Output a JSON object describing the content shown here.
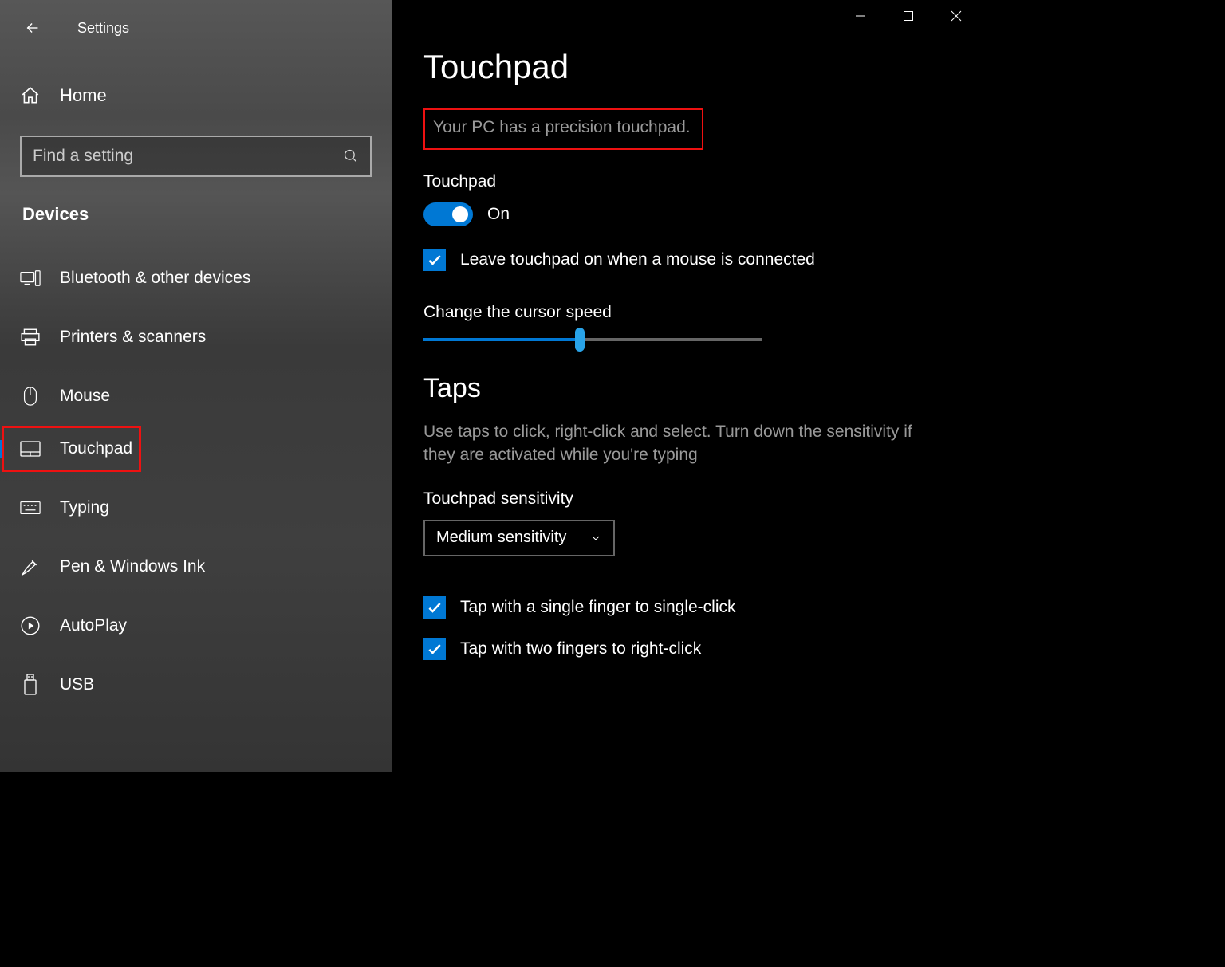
{
  "appTitle": "Settings",
  "home": "Home",
  "searchPlaceholder": "Find a setting",
  "category": "Devices",
  "nav": [
    {
      "label": "Bluetooth & other devices"
    },
    {
      "label": "Printers & scanners"
    },
    {
      "label": "Mouse"
    },
    {
      "label": "Touchpad"
    },
    {
      "label": "Typing"
    },
    {
      "label": "Pen & Windows Ink"
    },
    {
      "label": "AutoPlay"
    },
    {
      "label": "USB"
    }
  ],
  "page": {
    "title": "Touchpad",
    "precisionMsg": "Your PC has a precision touchpad.",
    "touchpadLabel": "Touchpad",
    "toggleState": "On",
    "leaveOn": "Leave touchpad on when a mouse is connected",
    "cursorSpeed": "Change the cursor speed",
    "tapsTitle": "Taps",
    "tapsDesc": "Use taps to click, right-click and select. Turn down the sensitivity if they are activated while you're typing",
    "sensitivityLabel": "Touchpad sensitivity",
    "sensitivityValue": "Medium sensitivity",
    "tapSingle": "Tap with a single finger to single-click",
    "tapTwo": "Tap with two fingers to right-click"
  },
  "colors": {
    "accent": "#0078d4",
    "highlight": "#e11"
  }
}
